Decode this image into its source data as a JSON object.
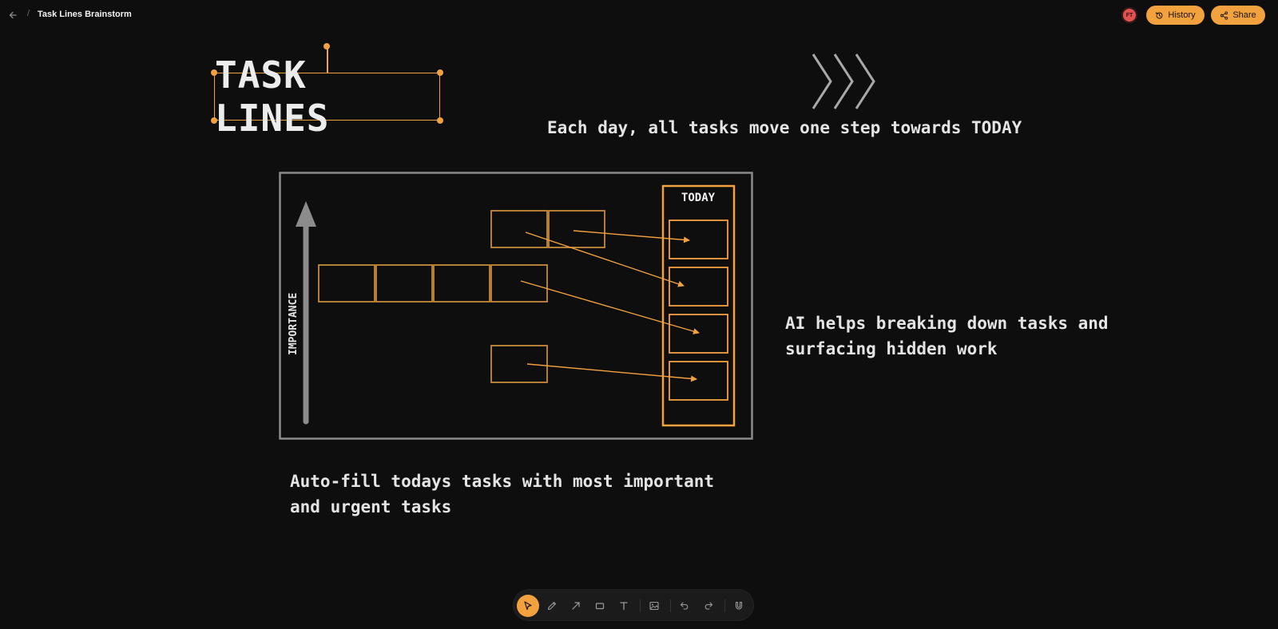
{
  "header": {
    "breadcrumb_separator": "/",
    "title": "Task Lines Brainstorm",
    "avatar_initials": "FT",
    "history_label": "History",
    "share_label": "Share"
  },
  "canvas": {
    "title": "TASK LINES",
    "caption_top": "Each day, all tasks move one step towards TODAY",
    "caption_right_line1": "AI helps breaking down tasks and",
    "caption_right_line2": "surfacing hidden work",
    "caption_bottom_line1": "Auto-fill todays tasks with most important",
    "caption_bottom_line2": "and urgent tasks",
    "diagram": {
      "today_label": "TODAY",
      "axis_label": "IMPORTANCE"
    }
  },
  "toolbar": {
    "tools": [
      "select-tool",
      "pen-tool",
      "arrow-tool",
      "rectangle-tool",
      "text-tool",
      "image-tool",
      "undo",
      "redo",
      "magnet-tool"
    ],
    "active_tool": "select-tool"
  },
  "colors": {
    "accent": "#f2a13f",
    "background": "#0f0e0e",
    "text": "#e6e6e6",
    "frame": "#8a8a8a",
    "avatar": "#e0524f"
  }
}
